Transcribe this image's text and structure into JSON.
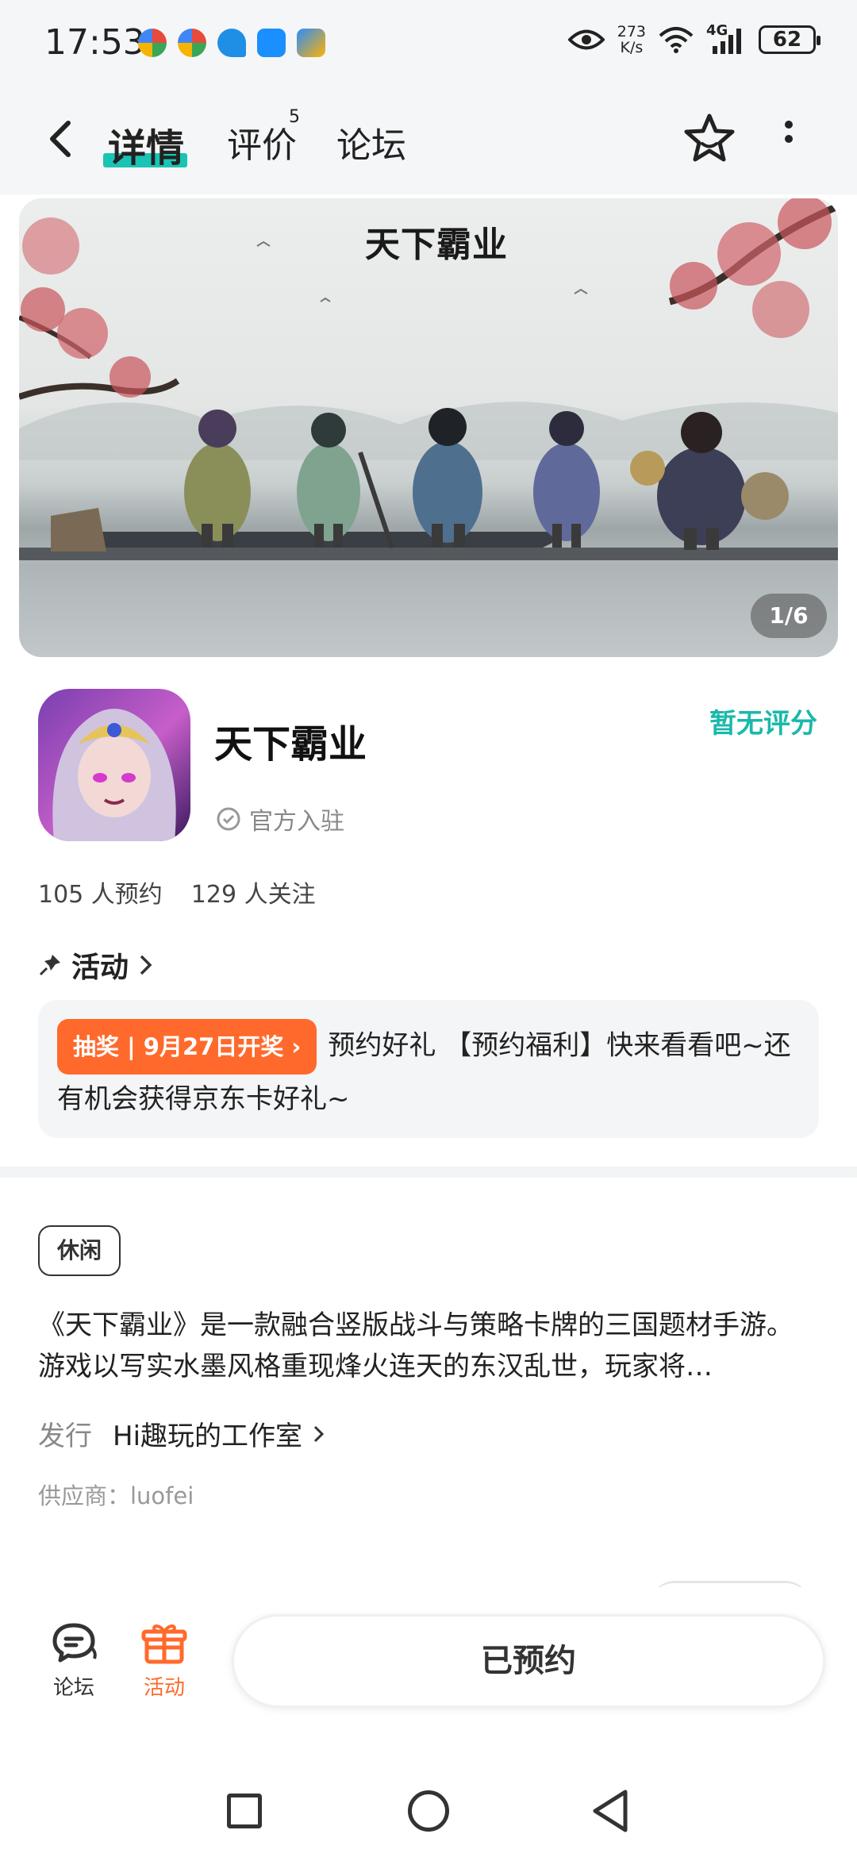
{
  "status_bar": {
    "time": "17:53",
    "net_speed_value": "273",
    "net_speed_unit": "K/s",
    "network": "4G",
    "battery": "62"
  },
  "nav": {
    "tabs": [
      {
        "label": "详情",
        "active": true
      },
      {
        "label": "评价",
        "badge": "5"
      },
      {
        "label": "论坛"
      }
    ]
  },
  "banner": {
    "logo_text": "天下霸业",
    "counter": "1/6"
  },
  "app": {
    "name": "天下霸业",
    "official": "官方入驻",
    "rating": "暂无评分",
    "reservations": "105 人预约",
    "followers": "129 人关注"
  },
  "activity": {
    "heading": "活动",
    "tag": "抽奖 | 9月27日开奖",
    "text": "预约好礼 【预约福利】快来看看吧~还有机会获得京东卡好礼~"
  },
  "details": {
    "genre": "休闲",
    "description": "《天下霸业》是一款融合竖版战斗与策略卡牌的三国题材手游。游戏以写实水墨风格重现烽火连天的东汉乱世，玩家将…",
    "publisher_label": "发行",
    "publisher_value": "Hi趣玩的工作室",
    "supplier": "供应商：luofei"
  },
  "bottom_bar": {
    "forum_label": "论坛",
    "activity_label": "活动",
    "reserve_button": "已预约"
  },
  "colors": {
    "accent": "#19c4b4",
    "orange": "#ff6a2c"
  }
}
